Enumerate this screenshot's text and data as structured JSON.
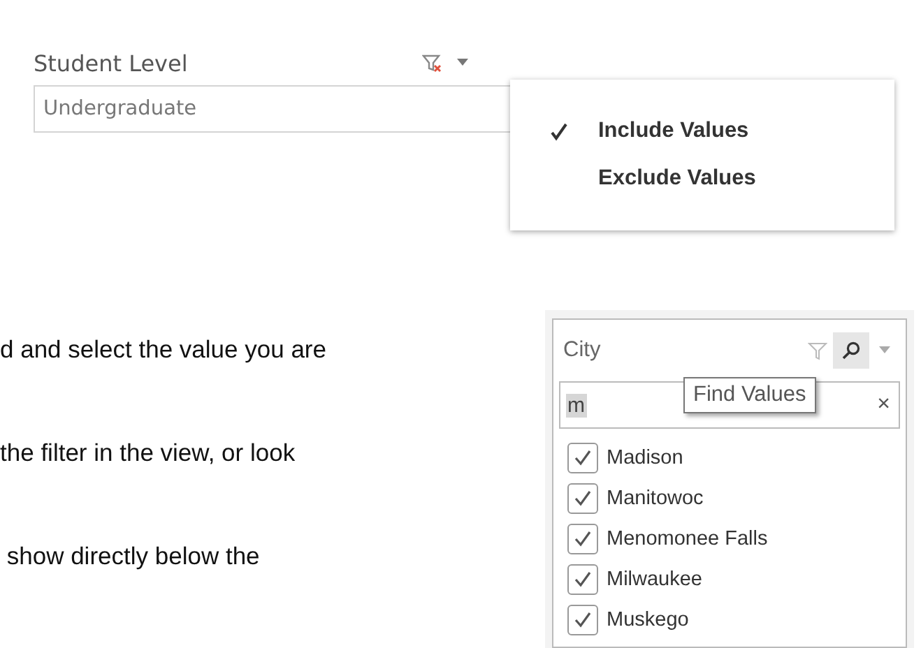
{
  "student_level_filter": {
    "title": "Student Level",
    "value": "Undergraduate",
    "menu": [
      {
        "label": "Include Values",
        "selected": true
      },
      {
        "label": "Exclude Values",
        "selected": false
      }
    ]
  },
  "body_text": [
    "d and select the value you are",
    "the filter in the view, or look",
    " show directly below the"
  ],
  "city_filter": {
    "title": "City",
    "search_value": "m",
    "clear_symbol": "×",
    "tooltip": "Find Values",
    "items": [
      {
        "label": "Madison",
        "checked": true
      },
      {
        "label": "Manitowoc",
        "checked": true
      },
      {
        "label": "Menomonee Falls",
        "checked": true
      },
      {
        "label": "Milwaukee",
        "checked": true
      },
      {
        "label": "Muskego",
        "checked": true
      }
    ]
  }
}
